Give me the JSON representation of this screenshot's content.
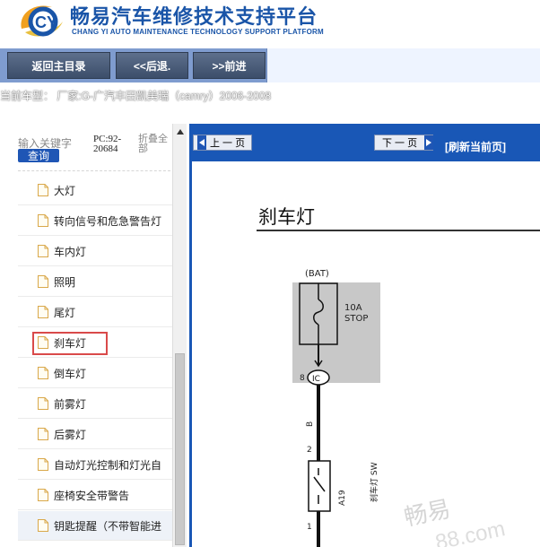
{
  "header": {
    "title": "畅易汽车维修技术支持平台",
    "subtitle": "CHANG YI AUTO MAINTENANCE TECHNOLOGY SUPPORT PLATFORM",
    "logo_icon": "cy-logo-icon",
    "logo_letters": "CY",
    "brand_color": "#1a55a8"
  },
  "nav": {
    "home_label": "返回主目录",
    "back_label": "<<后退.",
    "forward_label": ">>前进"
  },
  "car_info": "当前车型： 厂家:G-广汽丰田凯美瑞（camry）2006-2008",
  "sidebar": {
    "search_label": "输入关键字",
    "search_button": "查询",
    "pc_code": "PC:92-20684",
    "fold_all": "折叠全部",
    "items": [
      {
        "label": "大灯"
      },
      {
        "label": "转向信号和危急警告灯"
      },
      {
        "label": "车内灯"
      },
      {
        "label": "照明"
      },
      {
        "label": "尾灯"
      },
      {
        "label": "刹车灯",
        "selected": true
      },
      {
        "label": "倒车灯"
      },
      {
        "label": "前雾灯"
      },
      {
        "label": "后雾灯"
      },
      {
        "label": "自动灯光控制和灯光自"
      },
      {
        "label": "座椅安全带警告"
      },
      {
        "label": "钥匙提醒（不带智能进"
      }
    ]
  },
  "pager": {
    "prev_label": "上 一 页",
    "next_label": "下 一 页",
    "refresh_label": "[刷新当前页]"
  },
  "document": {
    "title": "刹车灯",
    "diagram": {
      "bat_label": "(BAT)",
      "fuse_rating": "10A",
      "fuse_name": "STOP",
      "connector_pin": "8",
      "connector_label": "IC",
      "wire_color": "B",
      "switch_pin_top": "2",
      "switch_code": "A19",
      "switch_name": "刹车灯 SW",
      "switch_pin_bottom": "1"
    }
  },
  "watermark": {
    "line1": "畅易",
    "line2": "88.com"
  },
  "colors": {
    "nav_bar": "#7f9ccf",
    "pager_bar": "#1957b6",
    "selected_outline": "#d94a4a",
    "search_button": "#1f56b5"
  }
}
